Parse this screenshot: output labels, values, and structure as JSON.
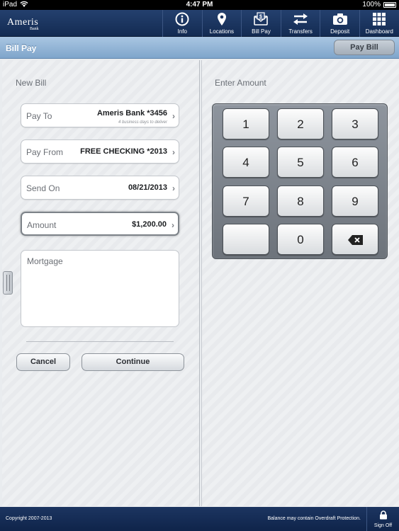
{
  "status_bar": {
    "carrier": "iPad",
    "time": "4:47 PM",
    "battery": "100%"
  },
  "nav": {
    "logo": {
      "name": "Ameris",
      "sub": "Bank"
    },
    "items": [
      {
        "label": "Info",
        "icon": "info-icon"
      },
      {
        "label": "Locations",
        "icon": "location-pin-icon"
      },
      {
        "label": "Bill Pay",
        "icon": "bill-pay-icon"
      },
      {
        "label": "Transfers",
        "icon": "transfer-arrows-icon"
      },
      {
        "label": "Deposit",
        "icon": "camera-icon"
      },
      {
        "label": "Dashboard",
        "icon": "grid-icon"
      }
    ]
  },
  "title_bar": {
    "title": "Bill Pay",
    "action_label": "Pay Bill"
  },
  "form": {
    "section_label": "New Bill",
    "pay_to": {
      "label": "Pay To",
      "value": "Ameris Bank *3456",
      "sub": "4 business days to deliver"
    },
    "pay_from": {
      "label": "Pay From",
      "value": "FREE CHECKING *2013"
    },
    "send_on": {
      "label": "Send On",
      "value": "08/21/2013"
    },
    "amount": {
      "label": "Amount",
      "value": "$1,200.00"
    },
    "memo": "Mortgage",
    "cancel_label": "Cancel",
    "continue_label": "Continue"
  },
  "keypad": {
    "section_label": "Enter Amount",
    "keys": [
      "1",
      "2",
      "3",
      "4",
      "5",
      "6",
      "7",
      "8",
      "9",
      "",
      "0",
      "backspace-icon"
    ]
  },
  "footer": {
    "copyright": "Copyright 2007-2013",
    "disclaimer": "Balance may contain Overdraft Protection.",
    "signoff_label": "Sign Off",
    "signoff_icon": "lock-icon"
  },
  "colors": {
    "nav_bg": "#1c3561",
    "title_bar_bg": "#93b4d6",
    "keypad_bg": "#7d848c"
  }
}
